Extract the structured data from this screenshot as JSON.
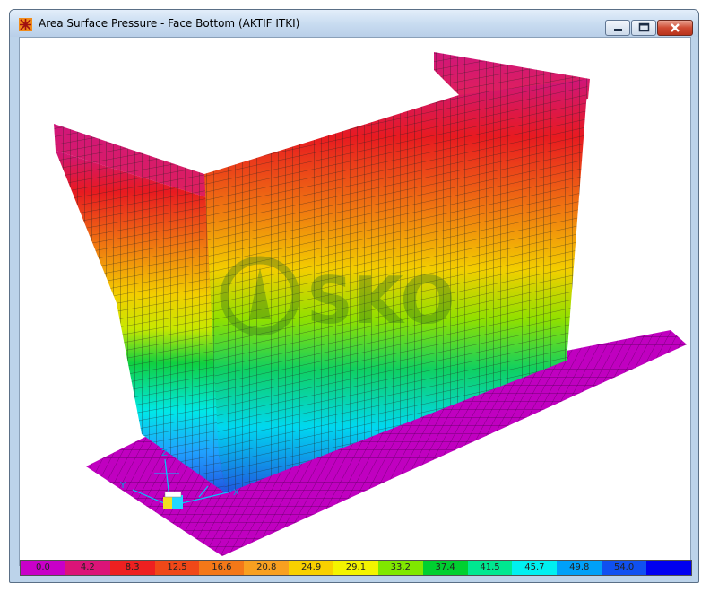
{
  "window": {
    "title": "Area Surface Pressure - Face Bottom (AKTIF ITKI)",
    "controls": [
      "minimize",
      "maximize",
      "close"
    ]
  },
  "viewport": {
    "watermark": "SKO",
    "axis_labels": [
      "Z",
      "Y",
      "X"
    ],
    "mesh_color": "#c000c0",
    "wall_gradient": [
      "#d0167a",
      "#e81a20",
      "#f07a10",
      "#f3ce00",
      "#c8e800",
      "#10d040",
      "#00e8e8",
      "#20a0ff",
      "#1f55e0"
    ]
  },
  "legend": {
    "labels": [
      "0.0",
      "4.2",
      "8.3",
      "12.5",
      "16.6",
      "20.8",
      "24.9",
      "29.1",
      "33.2",
      "37.4",
      "41.5",
      "45.7",
      "49.8",
      "54.0",
      ""
    ],
    "colors": [
      "#c800c8",
      "#dc1478",
      "#ee2020",
      "#f04818",
      "#f47818",
      "#f8a020",
      "#f8d000",
      "#f4f400",
      "#80e800",
      "#00d030",
      "#00e890",
      "#00f0f0",
      "#00a0f8",
      "#1050f0",
      "#0000f0"
    ]
  }
}
